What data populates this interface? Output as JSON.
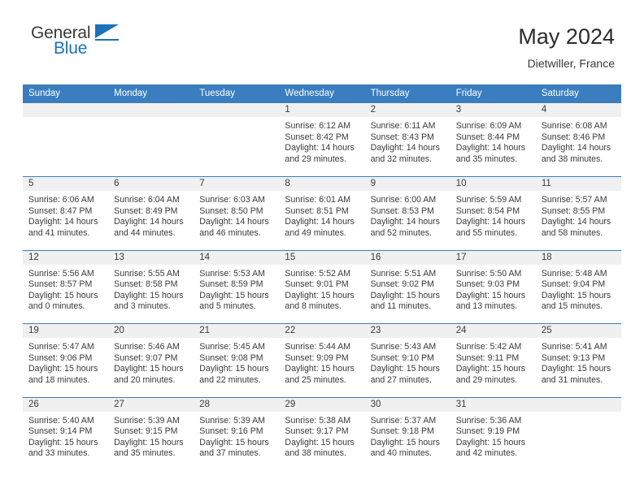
{
  "brand": {
    "name_part1": "General",
    "name_part2": "Blue",
    "logo_icon": "triangle-flag-icon",
    "accent_color": "#1b72b8"
  },
  "header": {
    "title": "May 2024",
    "subtitle": "Dietwiller, France"
  },
  "colors": {
    "header_blue": "#3a7ebf",
    "daynum_band": "#f0f0f0",
    "text": "#3a3a3a"
  },
  "weekday_headers": [
    "Sunday",
    "Monday",
    "Tuesday",
    "Wednesday",
    "Thursday",
    "Friday",
    "Saturday"
  ],
  "weeks": [
    [
      {
        "day": "",
        "sunrise": "",
        "sunset": "",
        "daylight1": "",
        "daylight2": ""
      },
      {
        "day": "",
        "sunrise": "",
        "sunset": "",
        "daylight1": "",
        "daylight2": ""
      },
      {
        "day": "",
        "sunrise": "",
        "sunset": "",
        "daylight1": "",
        "daylight2": ""
      },
      {
        "day": "1",
        "sunrise": "Sunrise: 6:12 AM",
        "sunset": "Sunset: 8:42 PM",
        "daylight1": "Daylight: 14 hours",
        "daylight2": "and 29 minutes."
      },
      {
        "day": "2",
        "sunrise": "Sunrise: 6:11 AM",
        "sunset": "Sunset: 8:43 PM",
        "daylight1": "Daylight: 14 hours",
        "daylight2": "and 32 minutes."
      },
      {
        "day": "3",
        "sunrise": "Sunrise: 6:09 AM",
        "sunset": "Sunset: 8:44 PM",
        "daylight1": "Daylight: 14 hours",
        "daylight2": "and 35 minutes."
      },
      {
        "day": "4",
        "sunrise": "Sunrise: 6:08 AM",
        "sunset": "Sunset: 8:46 PM",
        "daylight1": "Daylight: 14 hours",
        "daylight2": "and 38 minutes."
      }
    ],
    [
      {
        "day": "5",
        "sunrise": "Sunrise: 6:06 AM",
        "sunset": "Sunset: 8:47 PM",
        "daylight1": "Daylight: 14 hours",
        "daylight2": "and 41 minutes."
      },
      {
        "day": "6",
        "sunrise": "Sunrise: 6:04 AM",
        "sunset": "Sunset: 8:49 PM",
        "daylight1": "Daylight: 14 hours",
        "daylight2": "and 44 minutes."
      },
      {
        "day": "7",
        "sunrise": "Sunrise: 6:03 AM",
        "sunset": "Sunset: 8:50 PM",
        "daylight1": "Daylight: 14 hours",
        "daylight2": "and 46 minutes."
      },
      {
        "day": "8",
        "sunrise": "Sunrise: 6:01 AM",
        "sunset": "Sunset: 8:51 PM",
        "daylight1": "Daylight: 14 hours",
        "daylight2": "and 49 minutes."
      },
      {
        "day": "9",
        "sunrise": "Sunrise: 6:00 AM",
        "sunset": "Sunset: 8:53 PM",
        "daylight1": "Daylight: 14 hours",
        "daylight2": "and 52 minutes."
      },
      {
        "day": "10",
        "sunrise": "Sunrise: 5:59 AM",
        "sunset": "Sunset: 8:54 PM",
        "daylight1": "Daylight: 14 hours",
        "daylight2": "and 55 minutes."
      },
      {
        "day": "11",
        "sunrise": "Sunrise: 5:57 AM",
        "sunset": "Sunset: 8:55 PM",
        "daylight1": "Daylight: 14 hours",
        "daylight2": "and 58 minutes."
      }
    ],
    [
      {
        "day": "12",
        "sunrise": "Sunrise: 5:56 AM",
        "sunset": "Sunset: 8:57 PM",
        "daylight1": "Daylight: 15 hours",
        "daylight2": "and 0 minutes."
      },
      {
        "day": "13",
        "sunrise": "Sunrise: 5:55 AM",
        "sunset": "Sunset: 8:58 PM",
        "daylight1": "Daylight: 15 hours",
        "daylight2": "and 3 minutes."
      },
      {
        "day": "14",
        "sunrise": "Sunrise: 5:53 AM",
        "sunset": "Sunset: 8:59 PM",
        "daylight1": "Daylight: 15 hours",
        "daylight2": "and 5 minutes."
      },
      {
        "day": "15",
        "sunrise": "Sunrise: 5:52 AM",
        "sunset": "Sunset: 9:01 PM",
        "daylight1": "Daylight: 15 hours",
        "daylight2": "and 8 minutes."
      },
      {
        "day": "16",
        "sunrise": "Sunrise: 5:51 AM",
        "sunset": "Sunset: 9:02 PM",
        "daylight1": "Daylight: 15 hours",
        "daylight2": "and 11 minutes."
      },
      {
        "day": "17",
        "sunrise": "Sunrise: 5:50 AM",
        "sunset": "Sunset: 9:03 PM",
        "daylight1": "Daylight: 15 hours",
        "daylight2": "and 13 minutes."
      },
      {
        "day": "18",
        "sunrise": "Sunrise: 5:48 AM",
        "sunset": "Sunset: 9:04 PM",
        "daylight1": "Daylight: 15 hours",
        "daylight2": "and 15 minutes."
      }
    ],
    [
      {
        "day": "19",
        "sunrise": "Sunrise: 5:47 AM",
        "sunset": "Sunset: 9:06 PM",
        "daylight1": "Daylight: 15 hours",
        "daylight2": "and 18 minutes."
      },
      {
        "day": "20",
        "sunrise": "Sunrise: 5:46 AM",
        "sunset": "Sunset: 9:07 PM",
        "daylight1": "Daylight: 15 hours",
        "daylight2": "and 20 minutes."
      },
      {
        "day": "21",
        "sunrise": "Sunrise: 5:45 AM",
        "sunset": "Sunset: 9:08 PM",
        "daylight1": "Daylight: 15 hours",
        "daylight2": "and 22 minutes."
      },
      {
        "day": "22",
        "sunrise": "Sunrise: 5:44 AM",
        "sunset": "Sunset: 9:09 PM",
        "daylight1": "Daylight: 15 hours",
        "daylight2": "and 25 minutes."
      },
      {
        "day": "23",
        "sunrise": "Sunrise: 5:43 AM",
        "sunset": "Sunset: 9:10 PM",
        "daylight1": "Daylight: 15 hours",
        "daylight2": "and 27 minutes."
      },
      {
        "day": "24",
        "sunrise": "Sunrise: 5:42 AM",
        "sunset": "Sunset: 9:11 PM",
        "daylight1": "Daylight: 15 hours",
        "daylight2": "and 29 minutes."
      },
      {
        "day": "25",
        "sunrise": "Sunrise: 5:41 AM",
        "sunset": "Sunset: 9:13 PM",
        "daylight1": "Daylight: 15 hours",
        "daylight2": "and 31 minutes."
      }
    ],
    [
      {
        "day": "26",
        "sunrise": "Sunrise: 5:40 AM",
        "sunset": "Sunset: 9:14 PM",
        "daylight1": "Daylight: 15 hours",
        "daylight2": "and 33 minutes."
      },
      {
        "day": "27",
        "sunrise": "Sunrise: 5:39 AM",
        "sunset": "Sunset: 9:15 PM",
        "daylight1": "Daylight: 15 hours",
        "daylight2": "and 35 minutes."
      },
      {
        "day": "28",
        "sunrise": "Sunrise: 5:39 AM",
        "sunset": "Sunset: 9:16 PM",
        "daylight1": "Daylight: 15 hours",
        "daylight2": "and 37 minutes."
      },
      {
        "day": "29",
        "sunrise": "Sunrise: 5:38 AM",
        "sunset": "Sunset: 9:17 PM",
        "daylight1": "Daylight: 15 hours",
        "daylight2": "and 38 minutes."
      },
      {
        "day": "30",
        "sunrise": "Sunrise: 5:37 AM",
        "sunset": "Sunset: 9:18 PM",
        "daylight1": "Daylight: 15 hours",
        "daylight2": "and 40 minutes."
      },
      {
        "day": "31",
        "sunrise": "Sunrise: 5:36 AM",
        "sunset": "Sunset: 9:19 PM",
        "daylight1": "Daylight: 15 hours",
        "daylight2": "and 42 minutes."
      },
      {
        "day": "",
        "sunrise": "",
        "sunset": "",
        "daylight1": "",
        "daylight2": ""
      }
    ]
  ]
}
